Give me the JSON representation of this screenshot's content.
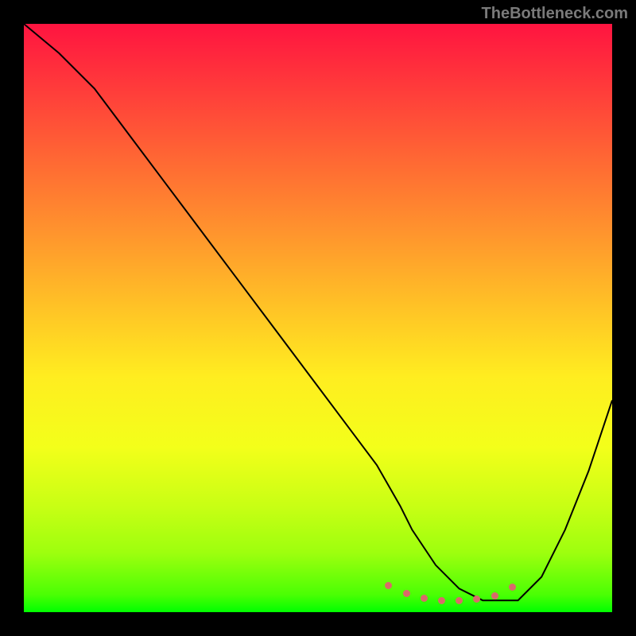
{
  "watermark": "TheBottleneck.com",
  "chart_data": {
    "type": "line",
    "title": "",
    "xlabel": "",
    "ylabel": "",
    "xlim": [
      0,
      100
    ],
    "ylim": [
      0,
      100
    ],
    "x": [
      0,
      6,
      12,
      18,
      24,
      30,
      36,
      42,
      48,
      54,
      60,
      64,
      66,
      70,
      74,
      78,
      82,
      84,
      88,
      92,
      96,
      100
    ],
    "values": [
      100,
      95,
      89,
      81,
      73,
      65,
      57,
      49,
      41,
      33,
      25,
      18,
      14,
      8,
      4,
      2,
      2,
      2,
      6,
      14,
      24,
      36
    ],
    "dot_x": [
      62,
      65,
      68,
      71,
      74,
      77,
      80,
      83
    ],
    "dot_y": [
      4.5,
      3.2,
      2.4,
      2.0,
      2.0,
      2.2,
      2.8,
      4.2
    ],
    "colors": {
      "top": "#ff1440",
      "bottom": "#00ff00",
      "curve": "#000000",
      "dots": "#d96a6a",
      "frame": "#000000"
    }
  }
}
